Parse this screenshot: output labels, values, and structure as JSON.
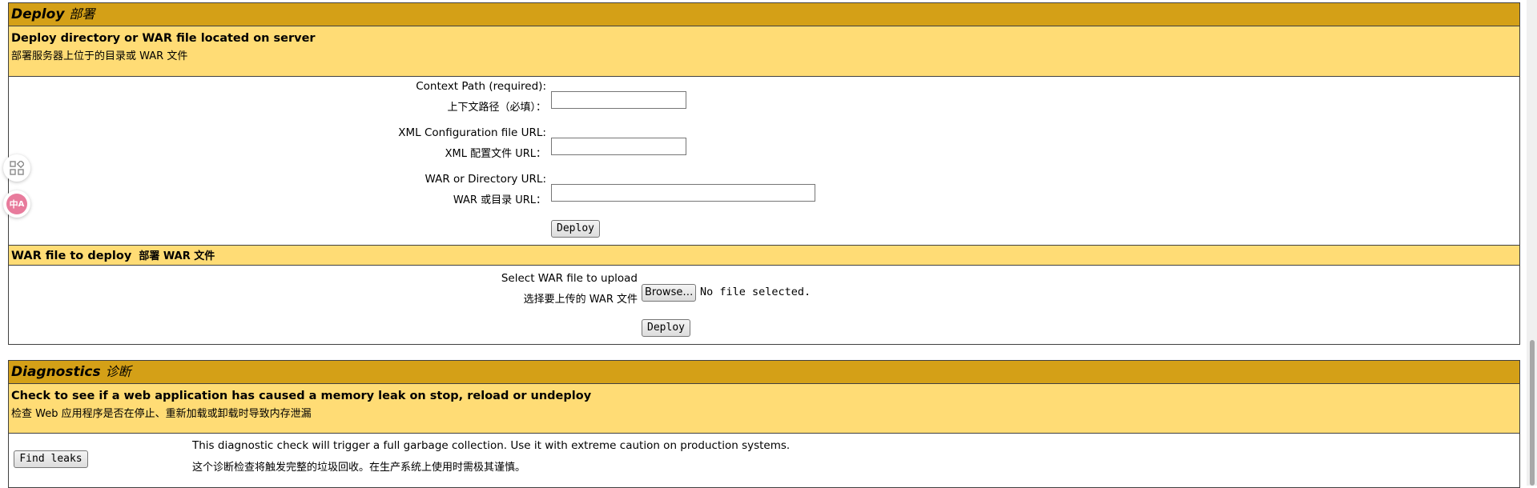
{
  "deploy": {
    "title": "Deploy",
    "title_cn": "部署",
    "dir_section": {
      "heading": "Deploy directory or WAR file located on server",
      "heading_cn": "部署服务器上位于的目录或 WAR 文件",
      "context_path_label": "Context Path (required):",
      "context_path_label_cn": "上下文路径（必填）：",
      "context_path_value": "",
      "xml_config_label": "XML Configuration file URL:",
      "xml_config_label_cn": "XML 配置文件 URL：",
      "xml_config_value": "",
      "war_dir_label": "WAR or Directory URL:",
      "war_dir_label_cn": "WAR 或目录 URL：",
      "war_dir_value": "",
      "deploy_button": "Deploy"
    },
    "war_upload": {
      "heading": "WAR file to deploy",
      "heading_cn": "部署 WAR 文件",
      "select_label": "Select WAR file to upload",
      "select_label_cn": "选择要上传的 WAR 文件",
      "browse_button": "Browse…",
      "file_status": "No file selected.",
      "deploy_button": "Deploy"
    }
  },
  "diagnostics": {
    "title": "Diagnostics",
    "title_cn": "诊断",
    "heading": "Check to see if a web application has caused a memory leak on stop, reload or undeploy",
    "heading_cn": "检查 Web 应用程序是否在停止、重新加载或卸载时导致内存泄漏",
    "find_leaks_button": "Find leaks",
    "description": "This diagnostic check will trigger a full garbage collection. Use it with extreme caution on production systems.",
    "description_cn": "这个诊断检查将触发完整的垃圾回收。在生产系统上使用时需极其谨慎。"
  },
  "floating_tools": {
    "icons": [
      "apps-grid-icon",
      "translate-icon"
    ],
    "translate_badge": "中",
    "translate_badge_b": "A"
  }
}
